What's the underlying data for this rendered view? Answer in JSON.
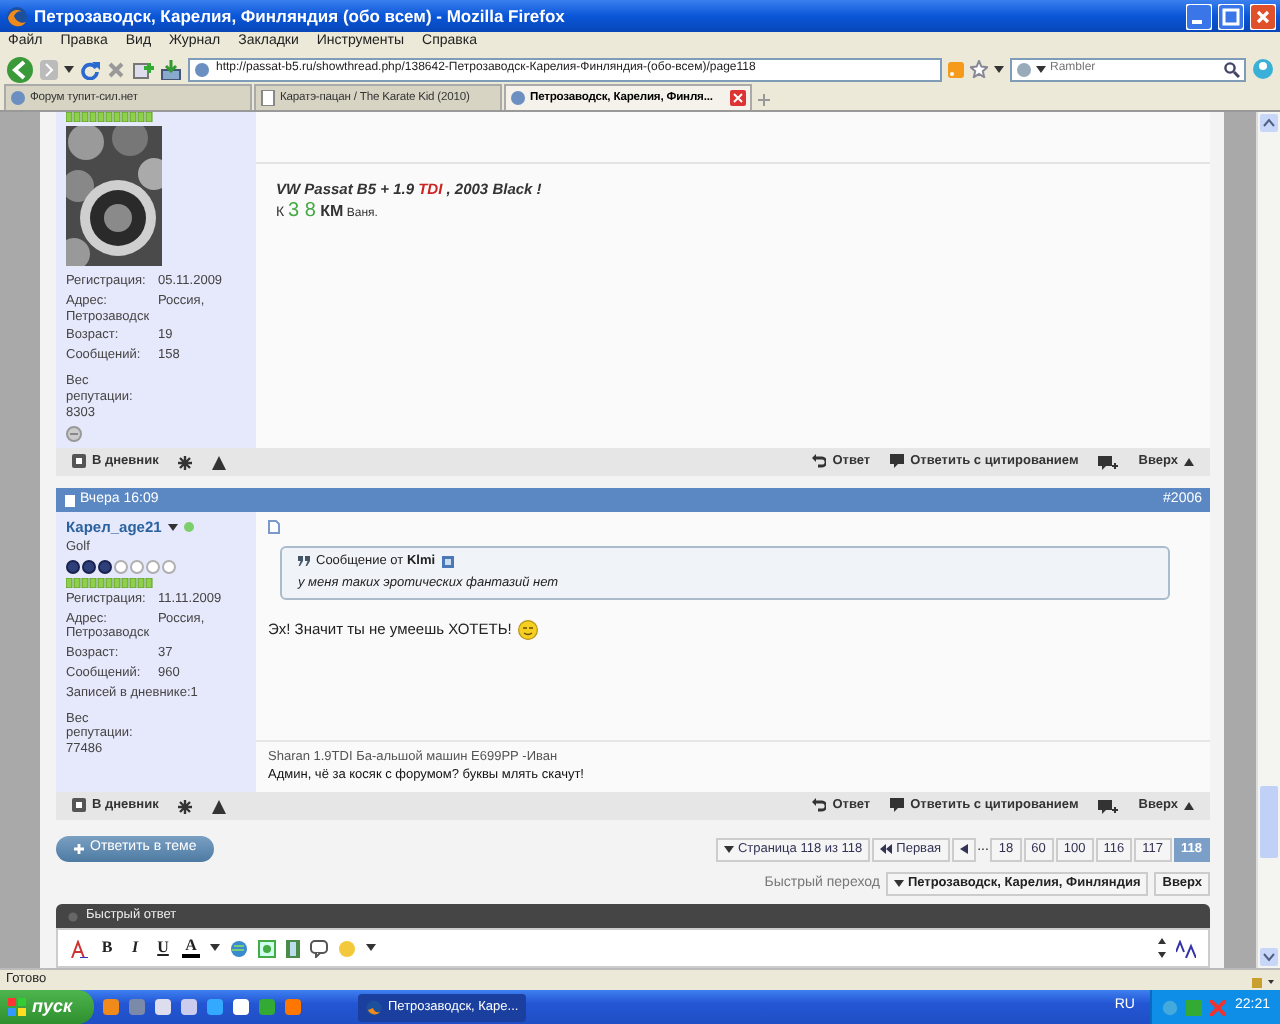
{
  "window": {
    "title": "Петрозаводск, Карелия, Финляндия (обо всем) - Mozilla Firefox"
  },
  "menu": [
    "Файл",
    "Правка",
    "Вид",
    "Журнал",
    "Закладки",
    "Инструменты",
    "Справка"
  ],
  "toolbar": {
    "url": "http://passat-b5.ru/showthread.php/138642-Петрозаводск-Карелия-Финляндия-(обо-всем)/page118",
    "search_placeholder": "Rambler"
  },
  "tabs": [
    {
      "label": "Форум тупит-сил.нет",
      "selected": false
    },
    {
      "label": "Каратэ-пацан / The Karate Kid (2010)",
      "selected": false
    },
    {
      "label": "Петрозаводск, Карелия, Финля...",
      "selected": true
    }
  ],
  "posts": [
    {
      "fields": [
        {
          "kind": "inline",
          "label": "Регистрация:",
          "value": "05.11.2009"
        },
        {
          "kind": "wrapped",
          "label": "Адрес:",
          "value": "Россия, Петрозаводск"
        },
        {
          "kind": "inline",
          "label": "Возраст:",
          "value": "19"
        },
        {
          "kind": "inline",
          "label": "Сообщений:",
          "value": "158"
        },
        {
          "kind": "stacked",
          "label": "Вес репутации:",
          "value": "8303"
        }
      ],
      "signature": [
        {
          "kind": "italic",
          "segments": [
            {
              "text": "VW Passat B5 + 1.9 ",
              "color": "#333333",
              "kind": "normal"
            },
            {
              "text": "TDI",
              "color": "#cc2222",
              "kind": "normal"
            },
            {
              "text": " , 2003 Black !",
              "color": "#333333",
              "kind": "normal"
            }
          ]
        },
        {
          "kind": "plain",
          "segments": [
            {
              "text": "К ",
              "color": "#333333",
              "kind": "normal"
            },
            {
              "text": "3 8",
              "color": "#44aa44",
              "kind": "large"
            },
            {
              "text": " КМ",
              "color": "#333333",
              "kind": "bold"
            },
            {
              "text": " Ваня.",
              "color": "#333333",
              "kind": "small"
            }
          ]
        }
      ],
      "actions": {
        "diary": "В дневник",
        "reply": "Ответ",
        "quote": "Ответить с цитированием",
        "top": "Вверх"
      }
    },
    {
      "date": "Вчера 16:09",
      "number": "#2006",
      "username": "Карел_age21",
      "online": true,
      "user_title": "Golf",
      "stars": 3,
      "fields": [
        {
          "kind": "inline",
          "label": "Регистрация:",
          "value": "11.11.2009"
        },
        {
          "kind": "wrapped",
          "label": "Адрес:",
          "value": "Россия, Петрозаводск"
        },
        {
          "kind": "inline",
          "label": "Возраст:",
          "value": "37"
        },
        {
          "kind": "inline",
          "label": "Сообщений:",
          "value": "960"
        },
        {
          "kind": "inline",
          "label": "Записей в дневнике:",
          "value": "1"
        },
        {
          "kind": "stacked",
          "label": "Вес репутации:",
          "value": "77486"
        }
      ],
      "quote": {
        "header": "Сообщение от **Klmi**",
        "text": "у меня таких эротических фантазий нет"
      },
      "message": "Эх! Значит ты не умеешь ХОТЕТЬ!",
      "signature": [
        {
          "kind": "plain",
          "segments": [
            {
              "text": "Sharan 1.9TDI Ба-альшой машин Е699РР -Иван",
              "color": "#555555",
              "kind": "normal"
            }
          ]
        },
        {
          "kind": "plain",
          "segments": [
            {
              "text": "Админ, чё за косяк с форумом? буквы млять скачут!",
              "color": "#111111",
              "kind": "normal"
            }
          ]
        }
      ],
      "actions": {
        "diary": "В дневник",
        "reply": "Ответ",
        "quote": "Ответить с цитированием",
        "top": "Вверх"
      }
    }
  ],
  "reply_button": "Ответить в теме",
  "pagination": {
    "page_label": "Страница 118 из 118",
    "first": "Первая",
    "ellipsis": "...",
    "pages": [
      {
        "label": "18",
        "selected": false
      },
      {
        "label": "60",
        "selected": false
      },
      {
        "label": "100",
        "selected": false
      },
      {
        "label": "116",
        "selected": false
      },
      {
        "label": "117",
        "selected": false
      },
      {
        "label": "118",
        "selected": true
      }
    ]
  },
  "quick_nav": {
    "label": "Быстрый переход",
    "forum": "Петрозаводск, Карелия, Финляндия",
    "top_button": "Вверх"
  },
  "quick_reply": {
    "title": "Быстрый ответ",
    "format_buttons": [
      "B",
      "I",
      "U",
      "A"
    ]
  },
  "status_bar": "Готово",
  "taskbar": {
    "start": "пуск",
    "tasks": [
      {
        "label": "Петрозаводск, Каре...",
        "selected": true
      }
    ],
    "language": "RU",
    "clock": "22:21"
  }
}
